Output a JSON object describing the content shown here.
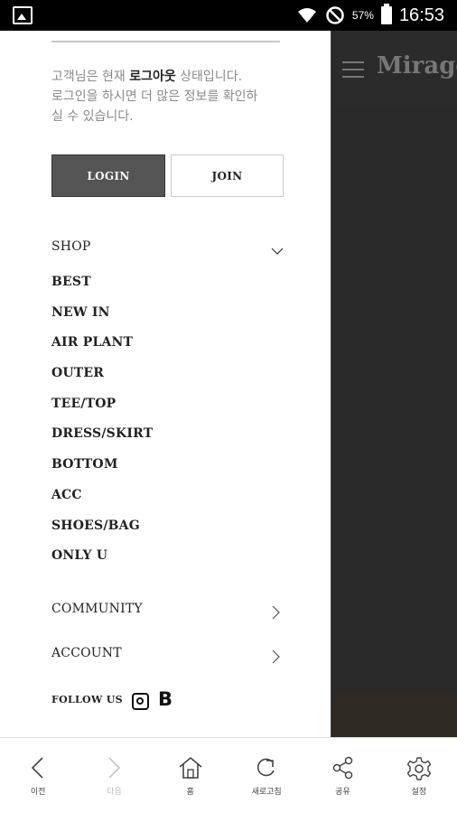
{
  "status_bar": {
    "battery": "57%",
    "time": "16:53"
  },
  "page": {
    "brand": "Mirage"
  },
  "drawer": {
    "notice_prefix": "고객님은 현재 ",
    "notice_status": "로그아웃",
    "notice_line1_suffix": " 상태입니다.",
    "notice_line2": "로그인을 하시면 더 많은 정보를 확인하",
    "notice_line3": "실 수 있습니다.",
    "login_label": "LOGIN",
    "join_label": "JOIN",
    "shop_label": "SHOP",
    "menu_items": [
      "BEST",
      "NEW IN",
      "AIR PLANT",
      "OUTER",
      "TEE/TOP",
      "DRESS/SKIRT",
      "BOTTOM",
      "ACC",
      "SHOES/BAG",
      "ONLY U"
    ],
    "community_label": "COMMUNITY",
    "account_label": "ACCOUNT",
    "follow_label": "FOLLOW US",
    "blog_letter": "B"
  },
  "bottom_bar": {
    "items": [
      {
        "label": "이전",
        "icon": "back-icon"
      },
      {
        "label": "다음",
        "icon": "forward-icon"
      },
      {
        "label": "홈",
        "icon": "home-icon"
      },
      {
        "label": "새로고침",
        "icon": "refresh-icon"
      },
      {
        "label": "공유",
        "icon": "share-icon"
      },
      {
        "label": "설정",
        "icon": "settings-icon"
      }
    ]
  }
}
